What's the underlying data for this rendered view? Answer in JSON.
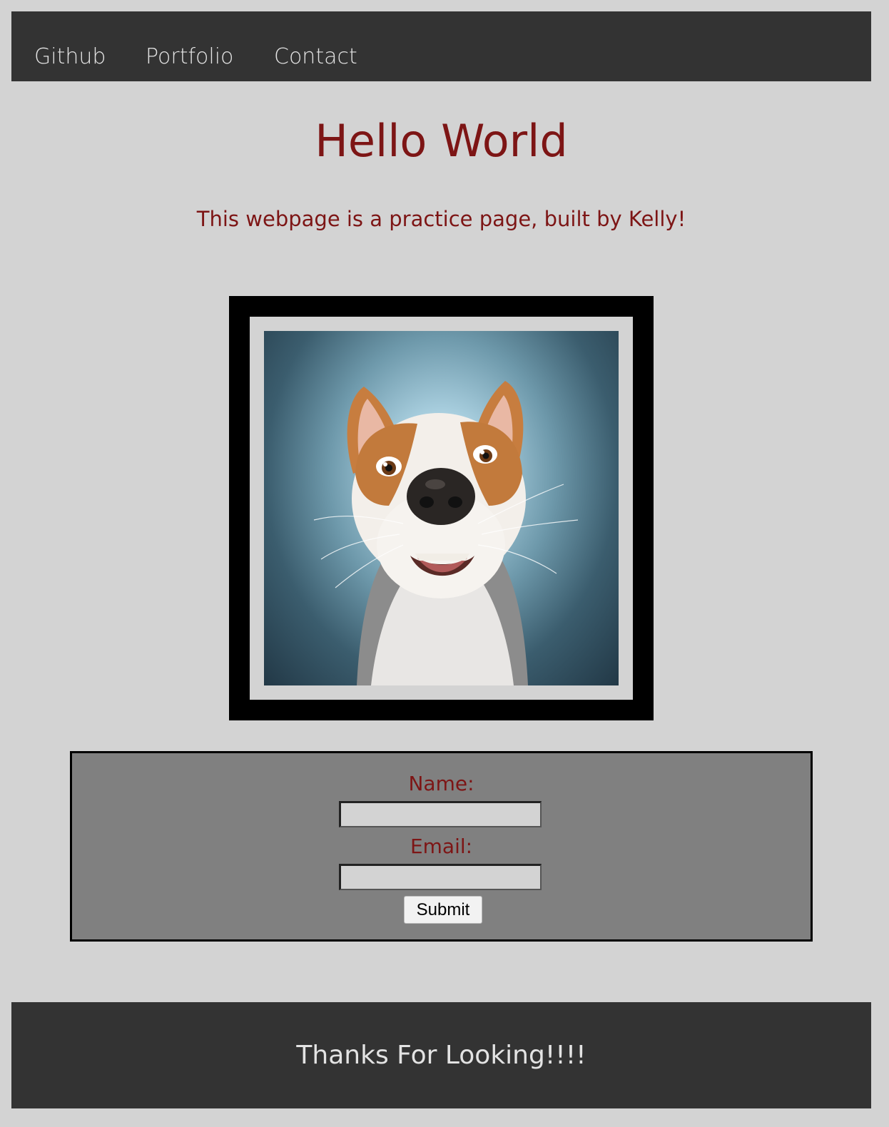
{
  "nav": {
    "items": [
      {
        "label": "Github"
      },
      {
        "label": "Portfolio"
      },
      {
        "label": "Contact"
      }
    ]
  },
  "header": {
    "title": "Hello World",
    "subtitle": "This webpage is a practice page, built by Kelly!"
  },
  "image": {
    "subject": "dog-photo"
  },
  "form": {
    "name_label": "Name:",
    "name_value": "",
    "email_label": "Email:",
    "email_value": "",
    "submit_label": "Submit"
  },
  "footer": {
    "text": "Thanks For Looking!!!!"
  },
  "colors": {
    "background": "#d3d3d3",
    "bar": "#333333",
    "accent_text": "#7d1515",
    "form_background": "#808080"
  }
}
